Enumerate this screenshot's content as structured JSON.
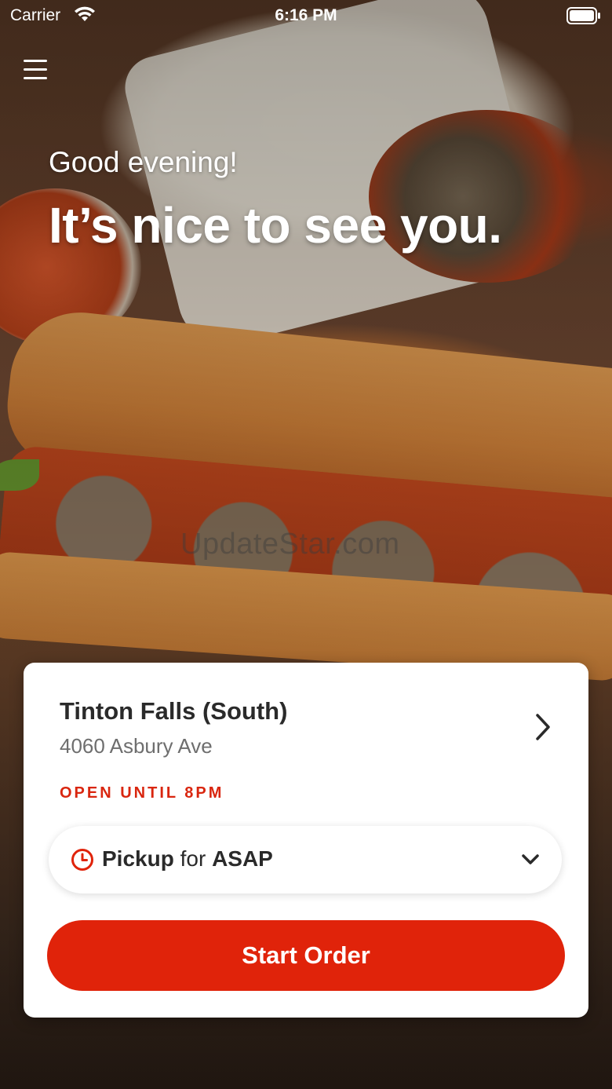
{
  "status_bar": {
    "carrier": "Carrier",
    "time": "6:16 PM"
  },
  "hero": {
    "greeting": "Good evening!",
    "headline": "It’s nice to see you.",
    "watermark": "UpdateStar.com"
  },
  "store": {
    "name": "Tinton Falls (South)",
    "address": "4060 Asbury Ave",
    "hours": "OPEN UNTIL 8PM"
  },
  "order_mode": {
    "mode": "Pickup",
    "connector": "for",
    "time": "ASAP"
  },
  "actions": {
    "start_order_label": "Start Order"
  },
  "colors": {
    "accent": "#e0230a",
    "hours_text": "#d9260f",
    "title_text": "#2a2a2a",
    "subtitle_text": "#6e6e6e"
  },
  "icons": {
    "menu": "hamburger-menu-icon",
    "store_link": "chevron-right-icon",
    "time": "clock-icon",
    "dropdown": "chevron-down-icon",
    "wifi": "wifi-icon",
    "battery": "battery-icon"
  }
}
